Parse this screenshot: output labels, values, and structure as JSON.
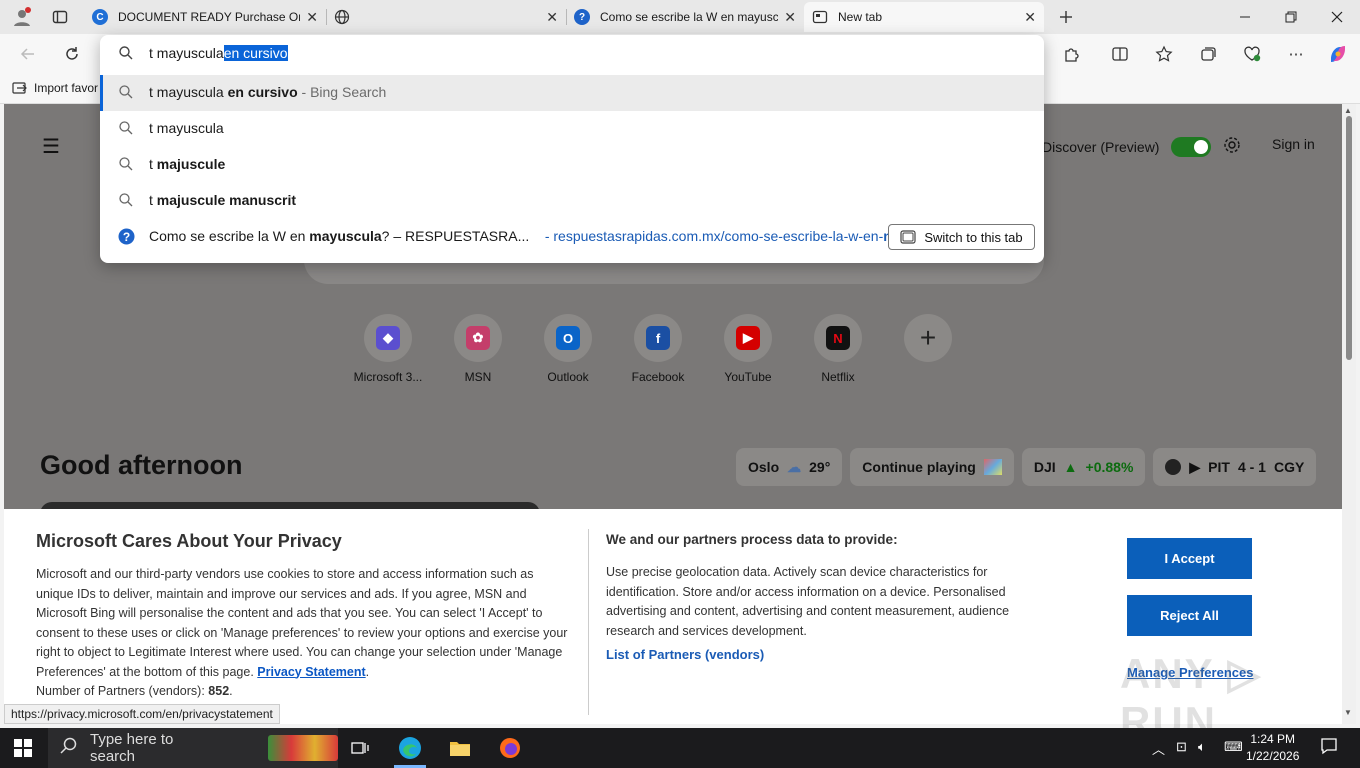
{
  "browser": {
    "tabs": [
      {
        "title": "DOCUMENT READY Purchase Ord",
        "favicon": "copilot-c-icon"
      },
      {
        "title": "",
        "favicon": "globe-icon"
      },
      {
        "title": "Como se escribe la W en mayuscu",
        "favicon": "help-icon"
      },
      {
        "title": "New tab",
        "favicon": "newtab-icon",
        "active": true
      }
    ]
  },
  "omnibox": {
    "typed": "t mayuscula",
    "autocomplete": "en cursivo"
  },
  "suggestions": [
    {
      "plain": "t mayuscula ",
      "bold": "en cursivo",
      "sub": " - Bing Search",
      "highlighted": true
    },
    {
      "plain": "t mayuscula",
      "bold": "",
      "sub": ""
    },
    {
      "plain": "t ",
      "bold": "majuscule",
      "sub": ""
    },
    {
      "plain": "t ",
      "bold": "majuscule manuscrit",
      "sub": ""
    }
  ],
  "tab_suggestion": {
    "pre": "Como se escribe la W en ",
    "bold": "mayuscula",
    "post": "? – RESPUESTASRA...",
    "url_pre": "- respuestasrapidas.com.mx/como-se-escribe-la-w-en-",
    "url_bold": "m...",
    "button": "Switch to this tab"
  },
  "favorites_bar": {
    "import_label": "Import favor"
  },
  "newtab": {
    "discover": "Discover (Preview)",
    "signin": "Sign in",
    "greeting": "Good afternoon",
    "tiles": [
      {
        "label": "Microsoft 3...",
        "icon": "m365-icon",
        "color": "#5b4fcf",
        "glyph": "◆"
      },
      {
        "label": "MSN",
        "icon": "msn-icon",
        "color": "#c43e6a",
        "glyph": "✿"
      },
      {
        "label": "Outlook",
        "icon": "outlook-icon",
        "color": "#0a64c8",
        "glyph": "O"
      },
      {
        "label": "Facebook",
        "icon": "facebook-icon",
        "color": "#1b4fa3",
        "glyph": "f"
      },
      {
        "label": "YouTube",
        "icon": "youtube-icon",
        "color": "#d40000",
        "glyph": "▶"
      },
      {
        "label": "Netflix",
        "icon": "netflix-icon",
        "color": "#111111",
        "glyph": "N"
      }
    ],
    "chips": {
      "weather_city": "Oslo",
      "weather_temp": "29°",
      "continue": "Continue playing",
      "stock": "DJI",
      "stock_change": "+0.88%",
      "score_a": "PIT",
      "score": "4 - 1",
      "score_b": "CGY"
    }
  },
  "consent": {
    "title": "Microsoft Cares About Your Privacy",
    "body": "Microsoft and our third-party vendors use cookies to store and access information such as unique IDs to deliver, maintain and improve our services and ads. If you agree, MSN and Microsoft Bing will personalise the content and ads that you see. You can select 'I Accept' to consent to these uses or click on 'Manage preferences' to review your options and exercise your right to object to Legitimate Interest where used.  You can change your selection under 'Manage Preferences' at the bottom of this page. ",
    "privacy_link": "Privacy Statement",
    "partners_count_label": "Number of Partners (vendors): ",
    "partners_count": "852",
    "h2": "We and our partners process data to provide:",
    "body2": "Use precise geolocation data. Actively scan device characteristics for identification. Store and/or access information on a device. Personalised advertising and content, advertising and content measurement, audience research and services development.",
    "partners_link": "List of Partners (vendors)",
    "accept": "I Accept",
    "reject": "Reject All",
    "manage": "Manage Preferences"
  },
  "status_url": "https://privacy.microsoft.com/en/privacystatement",
  "watermark": "ANY RUN",
  "taskbar": {
    "search_placeholder": "Type here to search",
    "time": "1:24 PM",
    "date": "1/22/2026"
  },
  "colors": {
    "accent": "#0a64d8",
    "consent_button": "#0b5fba",
    "link": "#1a5bb5"
  }
}
